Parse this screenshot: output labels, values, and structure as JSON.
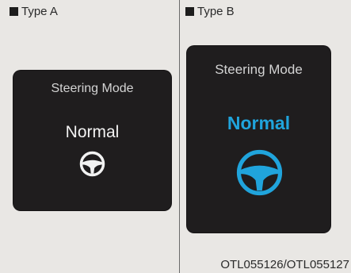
{
  "panel_a": {
    "type_label": "Type A",
    "screen": {
      "title": "Steering Mode",
      "mode": "Normal",
      "icon": "steering-wheel-icon"
    }
  },
  "panel_b": {
    "type_label": "Type B",
    "screen": {
      "title": "Steering Mode",
      "mode": "Normal",
      "icon": "steering-wheel-icon"
    }
  },
  "caption": "OTL055126/OTL055127",
  "colors": {
    "page_background": "#e9e7e4",
    "screen_background": "#1f1d1e",
    "type_a_mode": "#f2f2f2",
    "type_b_accent": "#20a4dc"
  }
}
